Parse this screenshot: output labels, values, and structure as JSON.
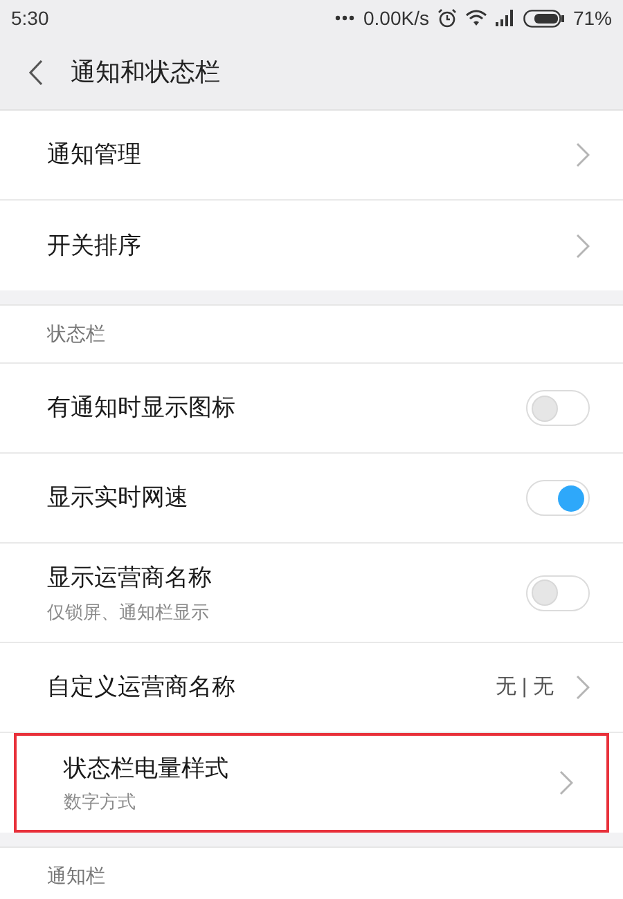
{
  "status_bar": {
    "time": "5:30",
    "speed": "0.00K/s",
    "battery": "71%"
  },
  "header": {
    "title": "通知和状态栏"
  },
  "sections": [
    {
      "items": [
        {
          "kind": "link",
          "label": "通知管理",
          "highlighted": false
        },
        {
          "kind": "link",
          "label": "开关排序",
          "highlighted": false
        }
      ]
    },
    {
      "title": "状态栏",
      "items": [
        {
          "kind": "toggle",
          "label": "有通知时显示图标",
          "on": false,
          "highlighted": false
        },
        {
          "kind": "toggle",
          "label": "显示实时网速",
          "on": true,
          "highlighted": false
        },
        {
          "kind": "toggle",
          "label": "显示运营商名称",
          "subtitle": "仅锁屏、通知栏显示",
          "on": false,
          "highlighted": false
        },
        {
          "kind": "link",
          "label": "自定义运营商名称",
          "value": "无 | 无",
          "highlighted": false
        },
        {
          "kind": "link",
          "label": "状态栏电量样式",
          "subtitle": "数字方式",
          "highlighted": true
        }
      ]
    },
    {
      "title": "通知栏"
    }
  ]
}
